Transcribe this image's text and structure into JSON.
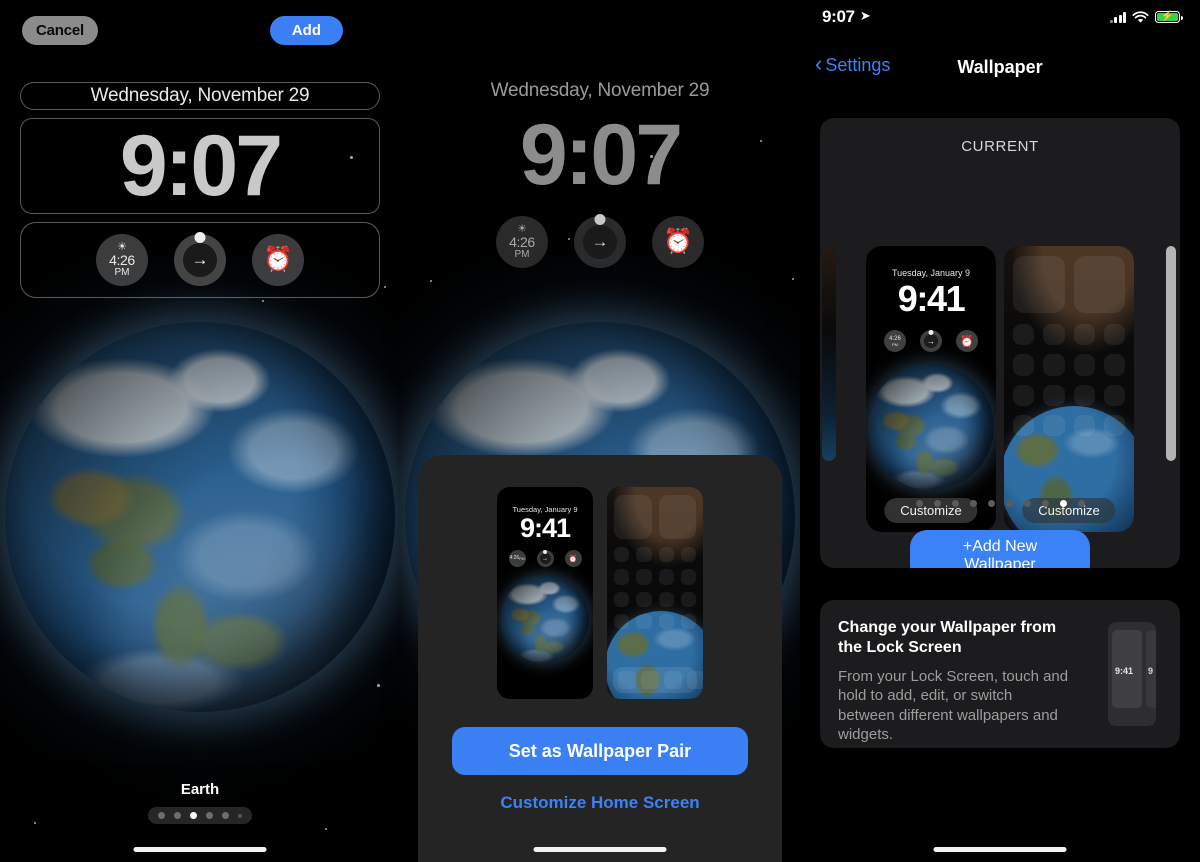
{
  "panel_edit": {
    "cancel_label": "Cancel",
    "add_label": "Add",
    "date": "Wednesday, November 29",
    "time": "9:07",
    "widgets": [
      {
        "name": "sunset",
        "glyph": "☀",
        "time": "4:26",
        "ampm": "PM"
      },
      {
        "name": "activity-ring",
        "glyph": "→"
      },
      {
        "name": "alarm",
        "glyph": "⏰"
      }
    ],
    "wallpaper_name": "Earth",
    "dots_total": 6,
    "dots_active_index": 2
  },
  "panel_preview": {
    "date": "Wednesday, November 29",
    "time": "9:07",
    "widgets": [
      {
        "name": "sunset",
        "time": "4:26",
        "ampm": "PM"
      },
      {
        "name": "activity-ring",
        "glyph": "→"
      },
      {
        "name": "alarm",
        "glyph": "⏰"
      }
    ],
    "mini_lock": {
      "date": "Tuesday, January 9",
      "time": "9:41",
      "w1_time": "4:26",
      "w1_ampm": "PM",
      "w2_glyph": "→",
      "w3_glyph": "⏰"
    },
    "set_pair_label": "Set as Wallpaper Pair",
    "customize_home_label": "Customize Home Screen"
  },
  "panel_settings": {
    "status_bar": {
      "time": "9:07",
      "location_icon": "location-arrow-icon",
      "signal_icon": "cellular-signal-icon",
      "wifi_icon": "wifi-icon",
      "battery_icon": "battery-charging-icon",
      "bolt_glyph": "⚡"
    },
    "nav": {
      "back_label": "Settings",
      "back_chevron": "‹",
      "title": "Wallpaper"
    },
    "current_card": {
      "section_title": "CURRENT",
      "lock_preview": {
        "date": "Tuesday, January 9",
        "time": "9:41",
        "w1_time": "4:26",
        "w1_ampm": "PM",
        "w2_glyph": "→",
        "w3_glyph": "⏰",
        "customize_label": "Customize"
      },
      "home_preview": {
        "customize_label": "Customize"
      },
      "dots_total": 10,
      "dots_active_index": 8,
      "add_wallpaper_label": "+Add New Wallpaper"
    },
    "info_card": {
      "heading": "Change your Wallpaper from the Lock Screen",
      "body": "From your Lock Screen, touch and hold to add, edit, or switch between different wallpapers and widgets.",
      "mini_time": "9:41",
      "mini_time_2": "9"
    }
  },
  "colors": {
    "accent_blue": "#3b82f7",
    "button_blue": "#3b7ff5",
    "cancel_gray": "#8b8b8b",
    "battery_green": "#3ad04a",
    "card_bg": "#1c1c1e"
  }
}
